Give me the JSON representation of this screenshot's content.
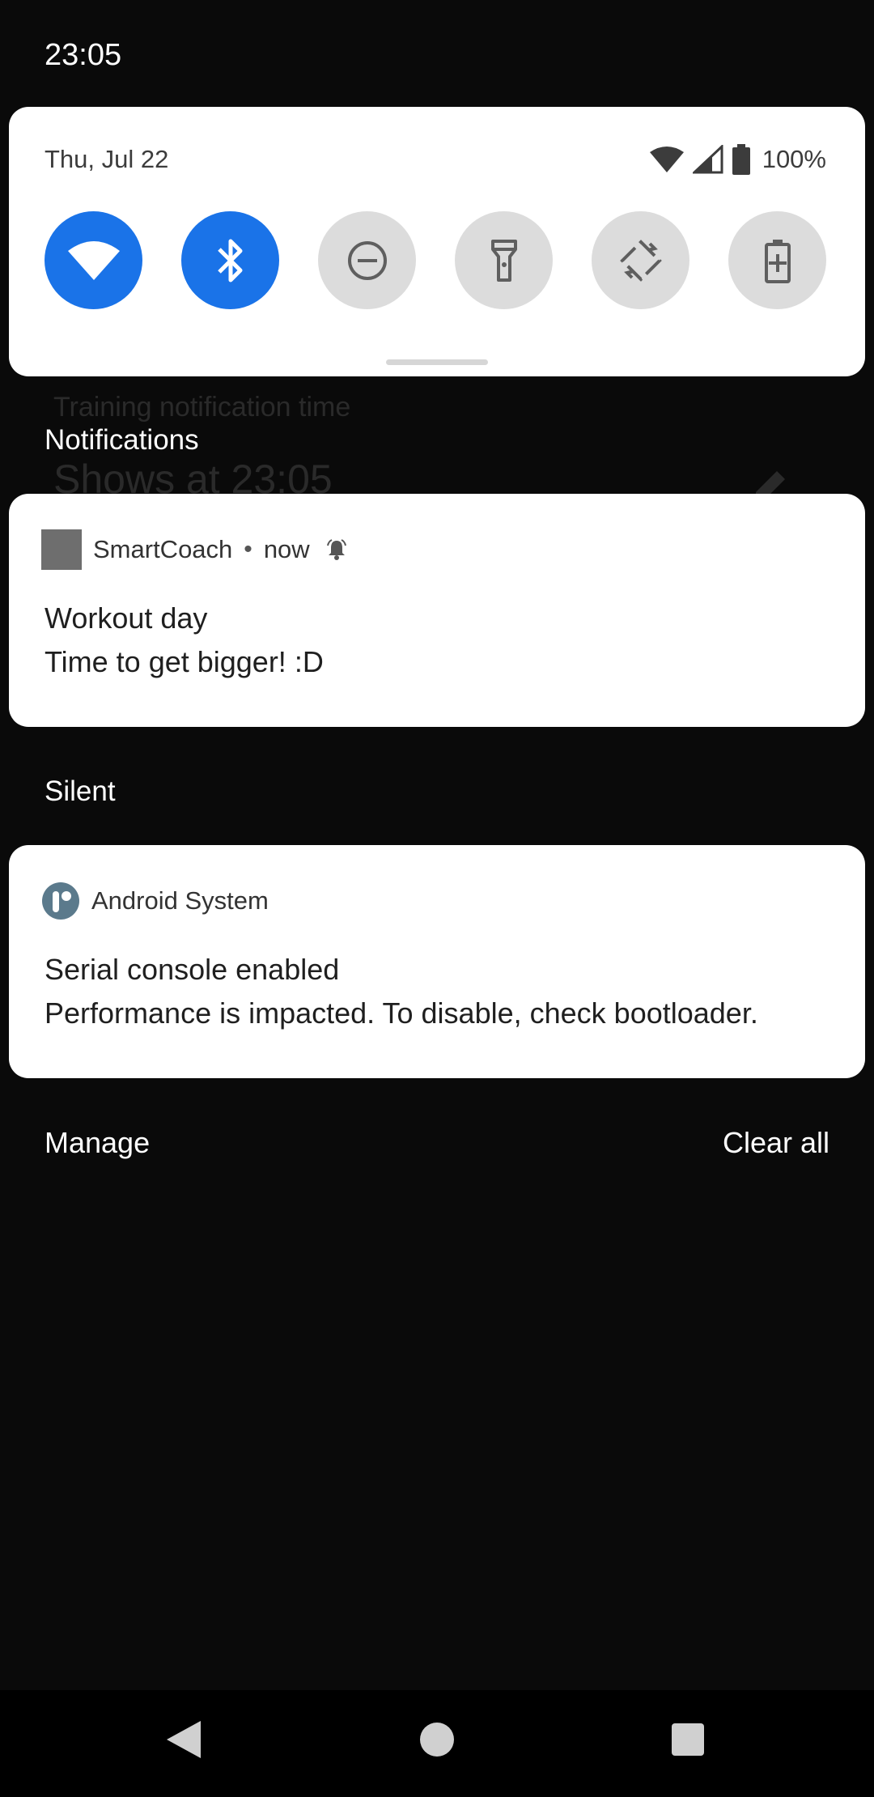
{
  "status_bar": {
    "time": "23:05"
  },
  "quick_settings": {
    "date": "Thu, Jul 22",
    "battery_percent": "100%",
    "tiles": [
      {
        "name": "wifi",
        "icon": "wifi-icon",
        "active": true
      },
      {
        "name": "bluetooth",
        "icon": "bluetooth-icon",
        "active": true
      },
      {
        "name": "do-not-disturb",
        "icon": "do-not-disturb-icon",
        "active": false
      },
      {
        "name": "flashlight",
        "icon": "flashlight-icon",
        "active": false
      },
      {
        "name": "auto-rotate",
        "icon": "auto-rotate-icon",
        "active": false
      },
      {
        "name": "battery-saver",
        "icon": "battery-saver-icon",
        "active": false
      }
    ],
    "active_color": "#1a73e8",
    "inactive_color": "#dcdcdc"
  },
  "background_app": {
    "setting_label": "Training notification time",
    "setting_value": "Shows at 23:05"
  },
  "sections": {
    "alerting_header": "Notifications",
    "silent_header": "Silent"
  },
  "notifications": [
    {
      "app_name": "SmartCoach",
      "time": "now",
      "separator": "•",
      "title": "Workout day",
      "text": "Time to get bigger! :D",
      "alert_icon": "bell-icon"
    },
    {
      "app_name": "Android System",
      "title": "Serial console enabled",
      "text": "Performance is impacted. To disable, check bootloader."
    }
  ],
  "footer": {
    "manage_label": "Manage",
    "clear_all_label": "Clear all"
  },
  "nav": [
    "back-icon",
    "home-icon",
    "recents-icon"
  ]
}
